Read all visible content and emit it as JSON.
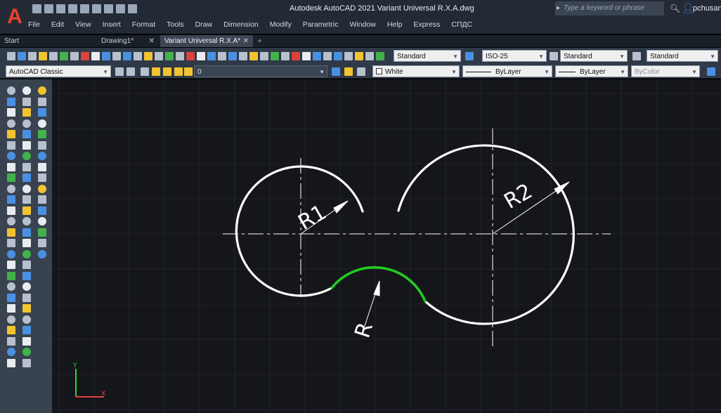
{
  "app": {
    "logo_letter": "A",
    "window_title": "Autodesk AutoCAD 2021   Variant Universal R.X.A.dwg",
    "search_placeholder": "Type a keyword or phrase",
    "username": "pchusanr"
  },
  "menu": [
    "File",
    "Edit",
    "View",
    "Insert",
    "Format",
    "Tools",
    "Draw",
    "Dimension",
    "Modify",
    "Parametric",
    "Window",
    "Help",
    "Express",
    "СПДС"
  ],
  "tabs": [
    {
      "label": "Start",
      "closable": false,
      "active": false
    },
    {
      "label": "Drawing1*",
      "closable": true,
      "active": false
    },
    {
      "label": "Variant Universal R.X.A*",
      "closable": true,
      "active": true
    }
  ],
  "styles_toolbar": {
    "text_style": "Standard",
    "dim_style": "ISO-25",
    "table_style": "Standard",
    "multileader_style": "Standard"
  },
  "properties_toolbar": {
    "workspace": "AutoCAD Classic",
    "layer": "0",
    "color": "White",
    "linetype": "ByLayer",
    "lineweight": "ByLayer",
    "plot_style": "ByColor"
  },
  "drawing": {
    "labels": {
      "r1": "R1",
      "r2": "R2",
      "r": "R"
    },
    "colors": {
      "background": "#14161a",
      "grid": "#2b3038",
      "geometry": "#ffffff",
      "highlight_arc": "#22cc22",
      "centerline": "#cfcfcf",
      "ucs_y": "#2fcf3a",
      "ucs_x": "#e04040"
    },
    "ucs": {
      "x_label": "X",
      "y_label": "Y"
    }
  },
  "toolbar_colors": {
    "gray": "#b7c0cc",
    "blue": "#4a90e2",
    "yellow": "#f2c230",
    "green": "#42b24a",
    "red": "#d9443a",
    "white": "#e8ecf0"
  }
}
